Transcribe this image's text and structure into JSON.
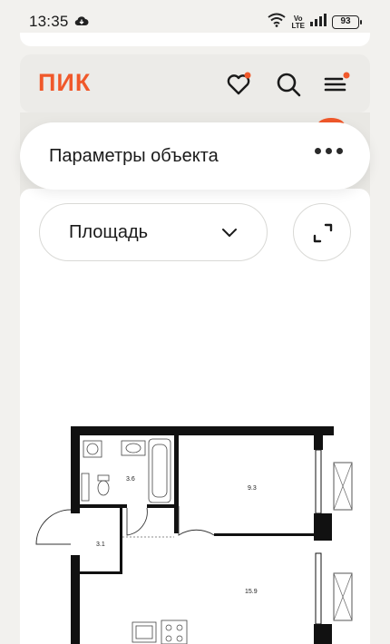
{
  "status_bar": {
    "time": "13:35",
    "volte_line1": "Vo",
    "volte_line2": "LTE",
    "battery": "93"
  },
  "header": {
    "logo": "ПИК",
    "brand_color": "#f0582a",
    "icons": [
      "heart-icon",
      "search-icon",
      "menu-icon"
    ]
  },
  "params_card": {
    "title": "Параметры объекта",
    "more_icon": "more-horizontal-icon"
  },
  "filter": {
    "selected": "Площадь",
    "expand_icon": "expand-icon"
  },
  "floor_plan": {
    "rooms": [
      {
        "label": "3.6"
      },
      {
        "label": "9.3"
      },
      {
        "label": "3.1"
      },
      {
        "label": "15.9"
      }
    ]
  }
}
